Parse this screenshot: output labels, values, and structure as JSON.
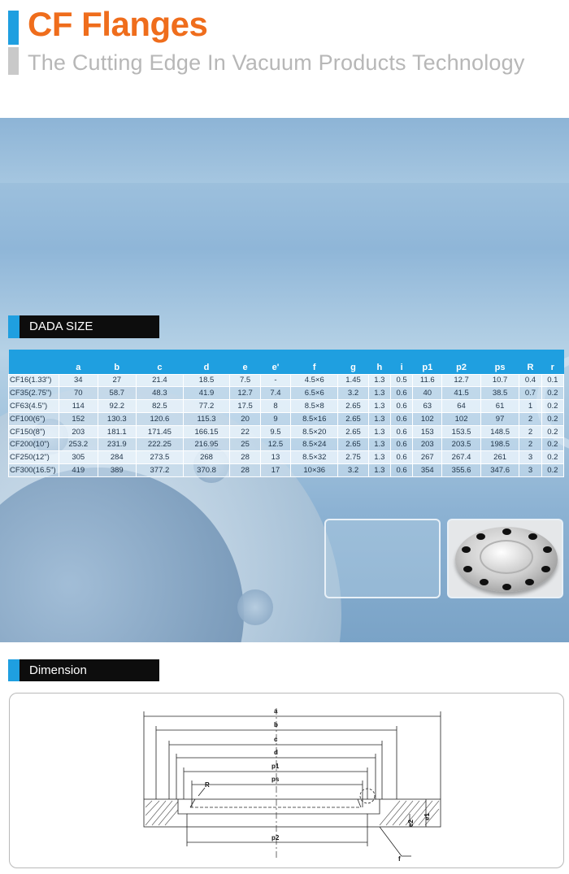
{
  "header": {
    "title": "CF Flanges",
    "subtitle": "The Cutting Edge In Vacuum Products Technology"
  },
  "size_section": {
    "heading": "DADA SIZE",
    "columns": [
      "",
      "a",
      "b",
      "c",
      "d",
      "e",
      "e'",
      "f",
      "g",
      "h",
      "i",
      "p1",
      "p2",
      "ps",
      "R",
      "r"
    ],
    "rows": [
      [
        "CF16(1.33\")",
        "34",
        "27",
        "21.4",
        "18.5",
        "7.5",
        "-",
        "4.5×6",
        "1.45",
        "1.3",
        "0.5",
        "11.6",
        "12.7",
        "10.7",
        "0.4",
        "0.1"
      ],
      [
        "CF35(2.75\")",
        "70",
        "58.7",
        "48.3",
        "41.9",
        "12.7",
        "7.4",
        "6.5×6",
        "3.2",
        "1.3",
        "0.6",
        "40",
        "41.5",
        "38.5",
        "0.7",
        "0.2"
      ],
      [
        "CF63(4.5\")",
        "114",
        "92.2",
        "82.5",
        "77.2",
        "17.5",
        "8",
        "8.5×8",
        "2.65",
        "1.3",
        "0.6",
        "63",
        "64",
        "61",
        "1",
        "0.2"
      ],
      [
        "CF100(6\")",
        "152",
        "130.3",
        "120.6",
        "115.3",
        "20",
        "9",
        "8.5×16",
        "2.65",
        "1.3",
        "0.6",
        "102",
        "102",
        "97",
        "2",
        "0.2"
      ],
      [
        "CF150(8\")",
        "203",
        "181.1",
        "171.45",
        "166.15",
        "22",
        "9.5",
        "8.5×20",
        "2.65",
        "1.3",
        "0.6",
        "153",
        "153.5",
        "148.5",
        "2",
        "0.2"
      ],
      [
        "CF200(10\")",
        "253.2",
        "231.9",
        "222.25",
        "216.95",
        "25",
        "12.5",
        "8.5×24",
        "2.65",
        "1.3",
        "0.6",
        "203",
        "203.5",
        "198.5",
        "2",
        "0.2"
      ],
      [
        "CF250(12\")",
        "305",
        "284",
        "273.5",
        "268",
        "28",
        "13",
        "8.5×32",
        "2.75",
        "1.3",
        "0.6",
        "267",
        "267.4",
        "261",
        "3",
        "0.2"
      ],
      [
        "CF300(16.5\")",
        "419",
        "389",
        "377.2",
        "370.8",
        "28",
        "17",
        "10×36",
        "3.2",
        "1.3",
        "0.6",
        "354",
        "355.6",
        "347.6",
        "3",
        "0.2"
      ]
    ]
  },
  "dimension_section": {
    "heading": "Dimension",
    "labels": {
      "a": "a",
      "b": "b",
      "c": "c",
      "d": "d",
      "p1": "p1",
      "ps": "ps",
      "R": "R",
      "e2": "e2",
      "e1": "e1",
      "p2": "p2",
      "f": "f"
    }
  },
  "colors": {
    "accent_blue": "#1f9fe0",
    "title_orange": "#ef6d1c",
    "subtitle_gray": "#b7b7b7",
    "heading_black": "#0d0d0d"
  }
}
